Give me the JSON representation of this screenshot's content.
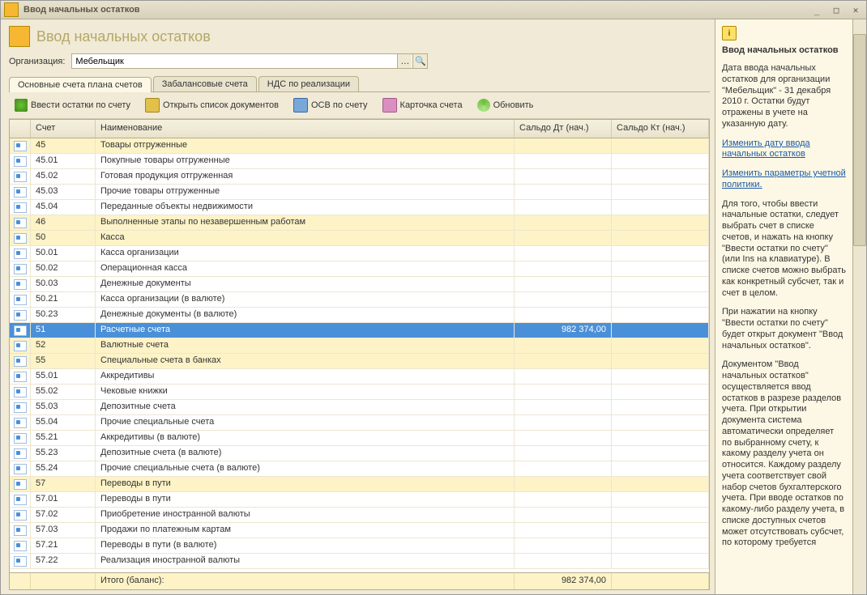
{
  "window": {
    "title": "Ввод начальных остатков"
  },
  "page": {
    "title": "Ввод начальных остатков"
  },
  "org": {
    "label": "Организация:",
    "value": "Мебельщик"
  },
  "tabs": [
    {
      "label": "Основные счета плана счетов",
      "active": true
    },
    {
      "label": "Забалансовые счета",
      "active": false
    },
    {
      "label": "НДС по реализации",
      "active": false
    }
  ],
  "toolbar": {
    "add": "Ввести остатки по счету",
    "open": "Открыть список документов",
    "osv": "ОСВ по счету",
    "card": "Карточка счета",
    "refresh": "Обновить"
  },
  "columns": {
    "acct": "Счет",
    "name": "Наименование",
    "dt": "Сальдо Дт (нач.)",
    "kt": "Сальдо Кт (нач.)"
  },
  "rows": [
    {
      "acct": "45",
      "name": "Товары отгруженные",
      "dt": "",
      "kt": "",
      "hl": true
    },
    {
      "acct": "45.01",
      "name": "Покупные товары отгруженные",
      "dt": "",
      "kt": ""
    },
    {
      "acct": "45.02",
      "name": "Готовая продукция отгруженная",
      "dt": "",
      "kt": ""
    },
    {
      "acct": "45.03",
      "name": "Прочие товары отгруженные",
      "dt": "",
      "kt": ""
    },
    {
      "acct": "45.04",
      "name": "Переданные объекты недвижимости",
      "dt": "",
      "kt": ""
    },
    {
      "acct": "46",
      "name": "Выполненные этапы по незавершенным работам",
      "dt": "",
      "kt": "",
      "hl": true
    },
    {
      "acct": "50",
      "name": "Касса",
      "dt": "",
      "kt": "",
      "hl": true
    },
    {
      "acct": "50.01",
      "name": "Касса организации",
      "dt": "",
      "kt": ""
    },
    {
      "acct": "50.02",
      "name": "Операционная касса",
      "dt": "",
      "kt": ""
    },
    {
      "acct": "50.03",
      "name": "Денежные документы",
      "dt": "",
      "kt": ""
    },
    {
      "acct": "50.21",
      "name": "Касса организации (в валюте)",
      "dt": "",
      "kt": ""
    },
    {
      "acct": "50.23",
      "name": "Денежные документы (в валюте)",
      "dt": "",
      "kt": ""
    },
    {
      "acct": "51",
      "name": "Расчетные счета",
      "dt": "982 374,00",
      "kt": "",
      "sel": true
    },
    {
      "acct": "52",
      "name": "Валютные счета",
      "dt": "",
      "kt": "",
      "hl": true
    },
    {
      "acct": "55",
      "name": "Специальные счета в банках",
      "dt": "",
      "kt": "",
      "hl": true
    },
    {
      "acct": "55.01",
      "name": "Аккредитивы",
      "dt": "",
      "kt": ""
    },
    {
      "acct": "55.02",
      "name": "Чековые книжки",
      "dt": "",
      "kt": ""
    },
    {
      "acct": "55.03",
      "name": "Депозитные счета",
      "dt": "",
      "kt": ""
    },
    {
      "acct": "55.04",
      "name": "Прочие специальные счета",
      "dt": "",
      "kt": ""
    },
    {
      "acct": "55.21",
      "name": "Аккредитивы (в валюте)",
      "dt": "",
      "kt": ""
    },
    {
      "acct": "55.23",
      "name": "Депозитные счета (в валюте)",
      "dt": "",
      "kt": ""
    },
    {
      "acct": "55.24",
      "name": "Прочие специальные счета (в валюте)",
      "dt": "",
      "kt": ""
    },
    {
      "acct": "57",
      "name": "Переводы в пути",
      "dt": "",
      "kt": "",
      "hl": true
    },
    {
      "acct": "57.01",
      "name": "Переводы в пути",
      "dt": "",
      "kt": ""
    },
    {
      "acct": "57.02",
      "name": "Приобретение иностранной валюты",
      "dt": "",
      "kt": ""
    },
    {
      "acct": "57.03",
      "name": "Продажи по платежным картам",
      "dt": "",
      "kt": ""
    },
    {
      "acct": "57.21",
      "name": "Переводы в пути (в валюте)",
      "dt": "",
      "kt": ""
    },
    {
      "acct": "57.22",
      "name": "Реализация иностранной валюты",
      "dt": "",
      "kt": ""
    }
  ],
  "footer": {
    "label": "Итого (баланс):",
    "dt": "982 374,00",
    "kt": ""
  },
  "help": {
    "title": "Ввод начальных остатков",
    "p1": "Дата ввода начальных остатков для организации \"Мебельщик\" - 31 декабря 2010 г. Остатки будут отражены в учете на указанную дату.",
    "link1": "Изменить дату ввода начальных остатков",
    "link2": "Изменить параметры учетной политики.",
    "p2": "Для того, чтобы ввести начальные остатки, следует выбрать счет в списке счетов, и нажать на кнопку \"Ввести остатки по счету\" (или Ins на клавиатуре). В списке счетов можно выбрать как конкретный субсчет, так и счет в целом.",
    "p3": "При нажатии на кнопку \"Ввести остатки по счету\" будет открыт документ \"Ввод начальных остатков\".",
    "p4": "Документом \"Ввод начальных остатков\" осуществляется ввод остатков в разрезе разделов учета. При открытии документа система автоматически определяет по выбранному счету, к какому разделу учета он относится. Каждому разделу учета соответствует свой набор счетов бухгалтерского учета. При вводе остатков по какому-либо разделу учета, в списке доступных счетов может отсутствовать субсчет, по которому требуется"
  }
}
